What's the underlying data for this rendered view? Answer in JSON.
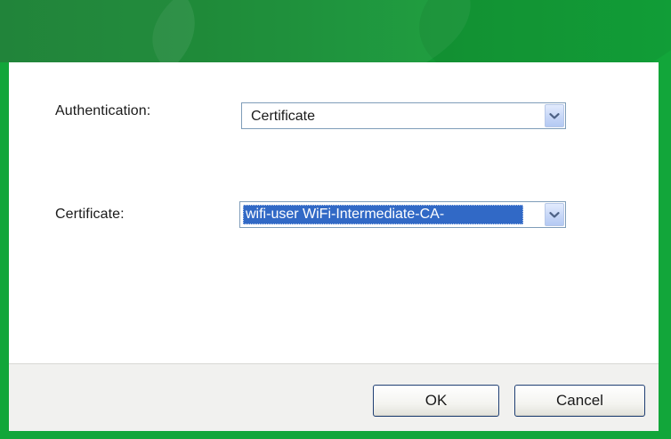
{
  "dialog": {
    "authentication": {
      "label": "Authentication:",
      "selected_value": "Certificate"
    },
    "certificate": {
      "label": "Certificate:",
      "selected_value": "wifi-user WiFi-Intermediate-CA-"
    },
    "buttons": {
      "ok_label": "OK",
      "cancel_label": "Cancel"
    }
  },
  "icons": {
    "dropdown": "chevron-down-icon"
  },
  "colors": {
    "title_bar": "#12a63a",
    "selection": "#3169c6",
    "footer": "#f1f1ef"
  }
}
